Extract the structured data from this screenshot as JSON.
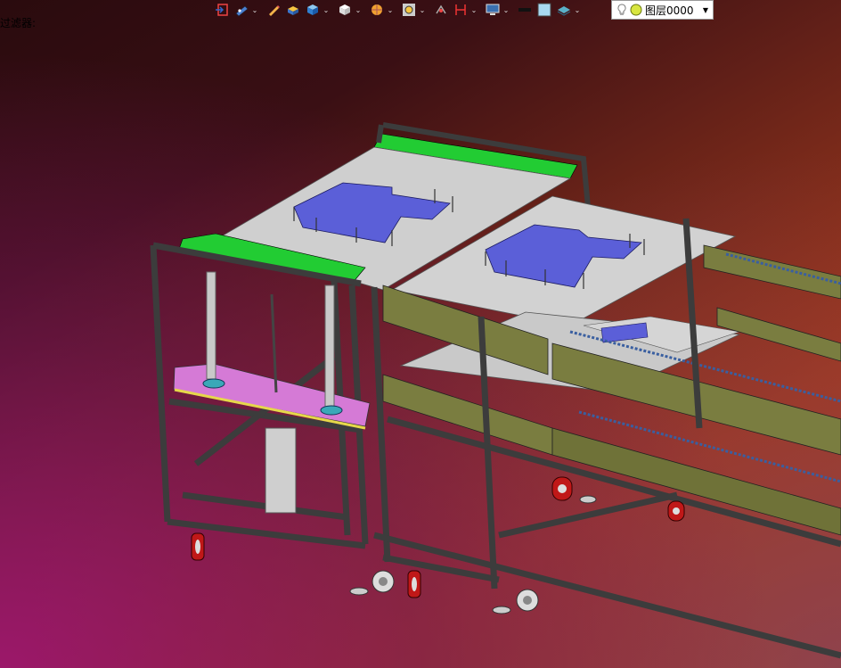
{
  "filter_label": "过滤器:",
  "toolbar": {
    "items": [
      {
        "name": "exit-icon"
      },
      {
        "name": "document-view-icon",
        "dropdown": true
      },
      {
        "name": "pencil-icon"
      },
      {
        "name": "material-icon"
      },
      {
        "name": "cube-icon",
        "dropdown": true
      },
      {
        "name": "box-icon",
        "dropdown": true
      },
      {
        "name": "render-icon",
        "dropdown": true
      },
      {
        "name": "zoom-icon",
        "dropdown": true
      },
      {
        "name": "transform-icon"
      },
      {
        "name": "measure-icon",
        "dropdown": true
      },
      {
        "name": "display-icon",
        "dropdown": true
      },
      {
        "name": "line-color-icon"
      },
      {
        "name": "fill-color-icon"
      },
      {
        "name": "layer-style-icon",
        "dropdown": true
      }
    ]
  },
  "layer": {
    "value": "图层0000"
  },
  "colors": {
    "frame": "#3c3c3c",
    "green_plate": "#22cc33",
    "blue_block": "#5b5fd8",
    "gray_plate": "#d0d0d0",
    "olive_beam": "#7a7d40",
    "pink_plate": "#d57ad6",
    "wheel_red": "#c01818"
  }
}
